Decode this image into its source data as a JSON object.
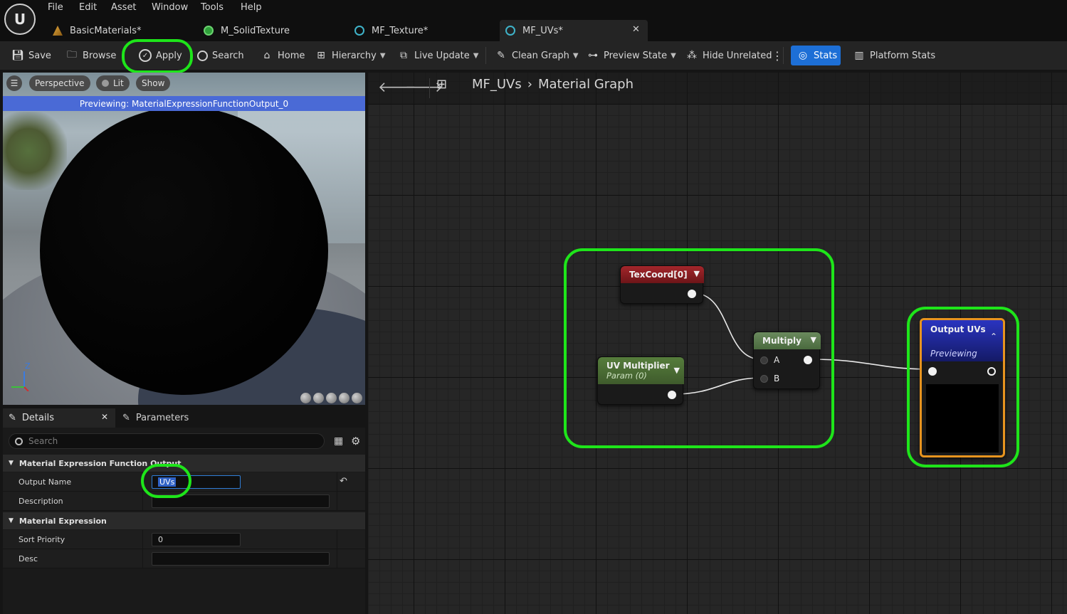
{
  "menu": [
    "File",
    "Edit",
    "Asset",
    "Window",
    "Tools",
    "Help"
  ],
  "tabs": [
    {
      "label": "BasicMaterials*"
    },
    {
      "label": "M_SolidTexture"
    },
    {
      "label": "MF_Texture*"
    },
    {
      "label": "MF_UVs*"
    }
  ],
  "toolbar": {
    "save": "Save",
    "browse": "Browse",
    "apply": "Apply",
    "search": "Search",
    "home": "Home",
    "hierarchy": "Hierarchy",
    "live_update": "Live Update",
    "clean_graph": "Clean Graph",
    "preview_state": "Preview State",
    "hide_unrelated": "Hide Unrelated",
    "stats": "Stats",
    "platform_stats": "Platform Stats"
  },
  "viewport": {
    "perspective": "Perspective",
    "lit": "Lit",
    "show": "Show",
    "banner": "Previewing: MaterialExpressionFunctionOutput_0",
    "axis_z": "Z"
  },
  "details": {
    "tab_details": "Details",
    "tab_parameters": "Parameters",
    "search_placeholder": "Search",
    "section1": "Material Expression Function Output",
    "output_name_label": "Output Name",
    "output_name_value": "UVs",
    "description_label": "Description",
    "section2": "Material Expression",
    "sort_priority_label": "Sort Priority",
    "sort_priority_value": "0",
    "desc_label": "Desc"
  },
  "graph": {
    "breadcrumb_root": "MF_UVs",
    "breadcrumb_leaf": "Material Graph",
    "nodes": {
      "texcoord": {
        "title": "TexCoord[0]",
        "color": "#8a1f24"
      },
      "uv_multiplier": {
        "title": "UV Multiplier",
        "subtitle": "Param (0)",
        "color": "#4e7238"
      },
      "multiply": {
        "title": "Multiply",
        "pin_a": "A",
        "pin_b": "B",
        "color": "#5a7a4e"
      },
      "output": {
        "title": "Output UVs",
        "subtitle": "Previewing",
        "color": "#1f2aa8"
      }
    }
  },
  "colors": {
    "highlight": "#1ee51a",
    "stats_button": "#1d6fd6",
    "preview_banner": "#4a6ad6",
    "output_border": "#e7941f"
  }
}
